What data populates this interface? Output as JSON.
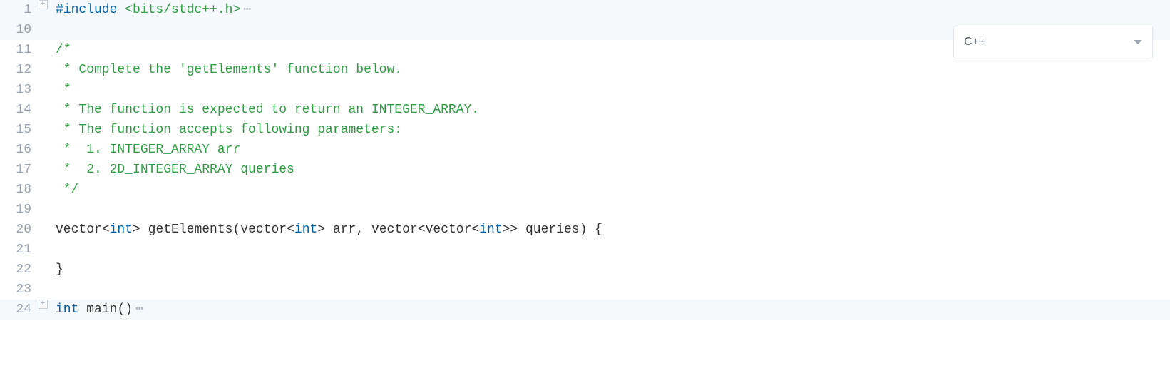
{
  "language_selector": {
    "selected": "C++"
  },
  "lines": [
    {
      "n": 1,
      "fold": "expand",
      "hl": true,
      "tokens": [
        {
          "c": "tok-pp",
          "t": "#include "
        },
        {
          "c": "tok-str",
          "t": "<bits/stdc++.h>"
        }
      ],
      "ellipsis": true
    },
    {
      "n": 10,
      "fold": "",
      "hl": true,
      "tokens": []
    },
    {
      "n": 11,
      "fold": "",
      "hl": false,
      "tokens": [
        {
          "c": "tok-comment",
          "t": "/*"
        }
      ]
    },
    {
      "n": 12,
      "fold": "",
      "hl": false,
      "tokens": [
        {
          "c": "tok-comment",
          "t": " * Complete the 'getElements' function below."
        }
      ]
    },
    {
      "n": 13,
      "fold": "",
      "hl": false,
      "tokens": [
        {
          "c": "tok-comment",
          "t": " *"
        }
      ]
    },
    {
      "n": 14,
      "fold": "",
      "hl": false,
      "tokens": [
        {
          "c": "tok-comment",
          "t": " * The function is expected to return an INTEGER_ARRAY."
        }
      ]
    },
    {
      "n": 15,
      "fold": "",
      "hl": false,
      "tokens": [
        {
          "c": "tok-comment",
          "t": " * The function accepts following parameters:"
        }
      ]
    },
    {
      "n": 16,
      "fold": "",
      "hl": false,
      "tokens": [
        {
          "c": "tok-comment",
          "t": " *  1. INTEGER_ARRAY arr"
        }
      ]
    },
    {
      "n": 17,
      "fold": "",
      "hl": false,
      "tokens": [
        {
          "c": "tok-comment",
          "t": " *  2. 2D_INTEGER_ARRAY queries"
        }
      ]
    },
    {
      "n": 18,
      "fold": "",
      "hl": false,
      "tokens": [
        {
          "c": "tok-comment",
          "t": " */"
        }
      ]
    },
    {
      "n": 19,
      "fold": "",
      "hl": false,
      "tokens": []
    },
    {
      "n": 20,
      "fold": "",
      "hl": false,
      "tokens": [
        {
          "c": "tok-ident",
          "t": "vector"
        },
        {
          "c": "tok-punct",
          "t": "<"
        },
        {
          "c": "tok-type",
          "t": "int"
        },
        {
          "c": "tok-punct",
          "t": "> "
        },
        {
          "c": "tok-fn",
          "t": "getElements"
        },
        {
          "c": "tok-punct",
          "t": "("
        },
        {
          "c": "tok-ident",
          "t": "vector"
        },
        {
          "c": "tok-punct",
          "t": "<"
        },
        {
          "c": "tok-type",
          "t": "int"
        },
        {
          "c": "tok-punct",
          "t": "> "
        },
        {
          "c": "tok-ident",
          "t": "arr"
        },
        {
          "c": "tok-punct",
          "t": ", "
        },
        {
          "c": "tok-ident",
          "t": "vector"
        },
        {
          "c": "tok-punct",
          "t": "<"
        },
        {
          "c": "tok-ident",
          "t": "vector"
        },
        {
          "c": "tok-punct",
          "t": "<"
        },
        {
          "c": "tok-type",
          "t": "int"
        },
        {
          "c": "tok-punct",
          "t": ">> "
        },
        {
          "c": "tok-ident",
          "t": "queries"
        },
        {
          "c": "tok-punct",
          "t": ") {"
        }
      ]
    },
    {
      "n": 21,
      "fold": "",
      "hl": false,
      "tokens": []
    },
    {
      "n": 22,
      "fold": "",
      "hl": false,
      "tokens": [
        {
          "c": "tok-punct",
          "t": "}"
        }
      ]
    },
    {
      "n": 23,
      "fold": "",
      "hl": false,
      "tokens": []
    },
    {
      "n": 24,
      "fold": "expand",
      "hl": true,
      "tokens": [
        {
          "c": "tok-type",
          "t": "int"
        },
        {
          "c": "tok-ident",
          "t": " "
        },
        {
          "c": "tok-fn",
          "t": "main"
        },
        {
          "c": "tok-punct",
          "t": "()"
        }
      ],
      "ellipsis": true
    }
  ]
}
